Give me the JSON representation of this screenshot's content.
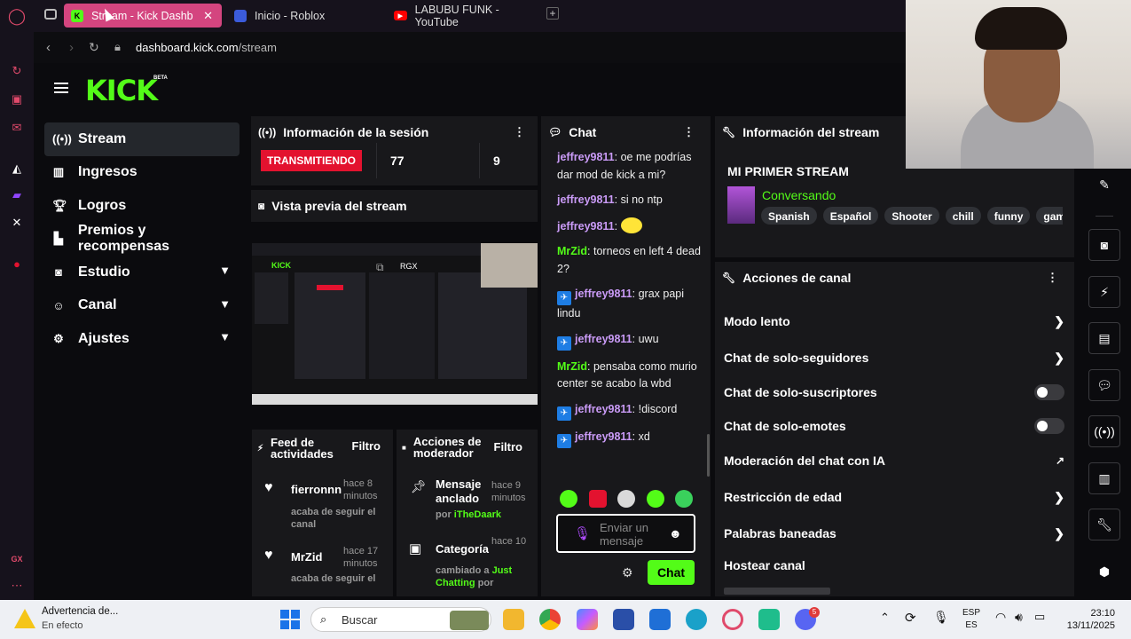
{
  "browser": {
    "tabs": [
      {
        "title": "Stream - Kick Dashb",
        "favicon": "K"
      },
      {
        "title": "Inicio - Roblox"
      },
      {
        "title": "LABUBU FUNK - YouTube"
      }
    ],
    "new_tab": "+",
    "url_host": "dashboard.kick.com",
    "url_path": "/stream"
  },
  "header": {
    "logo": "KICK",
    "beta": "BETA"
  },
  "sidebar": {
    "items": [
      {
        "label": "Stream",
        "icon": "live-icon"
      },
      {
        "label": "Ingresos",
        "icon": "chart-icon"
      },
      {
        "label": "Logros",
        "icon": "trophy-icon"
      },
      {
        "label": "Premios y recompensas",
        "icon": "gift-icon"
      },
      {
        "label": "Estudio",
        "icon": "studio-icon"
      },
      {
        "label": "Canal",
        "icon": "people-icon"
      },
      {
        "label": "Ajustes",
        "icon": "gear-icon"
      }
    ]
  },
  "session": {
    "title": "Información de la sesión",
    "live_badge": "TRANSMITIENDO",
    "stat1": "77",
    "stat2": "9"
  },
  "preview": {
    "title": "Vista previa del stream",
    "mini_logo": "KICK",
    "overlay_label": "RGX"
  },
  "feed": {
    "title": "Feed de actividades",
    "filter": "Filtro",
    "items": [
      {
        "user": "fierronnn",
        "time": "hace 8 minutos",
        "text": "acaba de seguir el canal"
      },
      {
        "user": "MrZid",
        "time": "hace 17 minutos",
        "text": "acaba de seguir el"
      }
    ]
  },
  "mod": {
    "title": "Acciones de moderador",
    "filter": "Filtro",
    "items": [
      {
        "label": "Mensaje anclado",
        "time": "hace 9 minutos",
        "sub": "por",
        "who": "iTheDaark"
      },
      {
        "label": "Categoría",
        "time": "hace 10",
        "sub": "cambiado a",
        "who": "Just Chatting",
        "after": "por"
      }
    ]
  },
  "chat": {
    "title": "Chat",
    "messages": [
      {
        "user": "jeffrey9811",
        "text": "oe me podrías dar mod de kick a mi?",
        "color": "purple"
      },
      {
        "user": "jeffrey9811",
        "text": "si no ntp",
        "color": "purple"
      },
      {
        "user": "jeffrey9811",
        "text": "",
        "color": "purple",
        "emote": true
      },
      {
        "user": "MrZid",
        "text": "torneos en left 4 dead 2?",
        "color": "green"
      },
      {
        "user": "jeffrey9811",
        "text": "grax papi lindu",
        "color": "purple",
        "badge": true
      },
      {
        "user": "jeffrey9811",
        "text": "uwu",
        "color": "purple",
        "badge": true
      },
      {
        "user": "MrZid",
        "text": "pensaba como murio center se acabo la wbd",
        "color": "green"
      },
      {
        "user": "jeffrey9811",
        "text": "!discord",
        "color": "purple",
        "badge": true
      },
      {
        "user": "jeffrey9811",
        "text": "xd",
        "color": "purple",
        "badge": true
      }
    ],
    "input_placeholder": "Enviar un mensaje",
    "send_label": "Chat"
  },
  "stream_info": {
    "title": "Información del stream",
    "stream_title": "MI PRIMER STREAM",
    "category": "Conversando",
    "tags": [
      "Spanish",
      "Español",
      "Shooter",
      "chill",
      "funny",
      "gaming"
    ]
  },
  "channel_actions": {
    "title": "Acciones de canal",
    "items": [
      {
        "label": "Modo lento",
        "type": "arrow"
      },
      {
        "label": "Chat de solo-seguidores",
        "type": "arrow"
      },
      {
        "label": "Chat de solo-suscriptores",
        "type": "toggle"
      },
      {
        "label": "Chat de solo-emotes",
        "type": "toggle"
      },
      {
        "label": "Moderación del chat con IA",
        "type": "external"
      },
      {
        "label": "Restricción de edad",
        "type": "arrow"
      },
      {
        "label": "Palabras baneadas",
        "type": "arrow"
      },
      {
        "label": "Hostear canal",
        "type": "none"
      }
    ]
  },
  "taskbar": {
    "notif_title": "Advertencia de...",
    "notif_sub": "En efecto",
    "search": "Buscar",
    "lang1": "ESP",
    "lang2": "ES",
    "time": "23:10",
    "date": "13/11/2025",
    "discord_badge": "5"
  },
  "colors": {
    "kick_green": "#53fc18",
    "live_red": "#e3122f",
    "opera_tab": "#d4457f"
  }
}
